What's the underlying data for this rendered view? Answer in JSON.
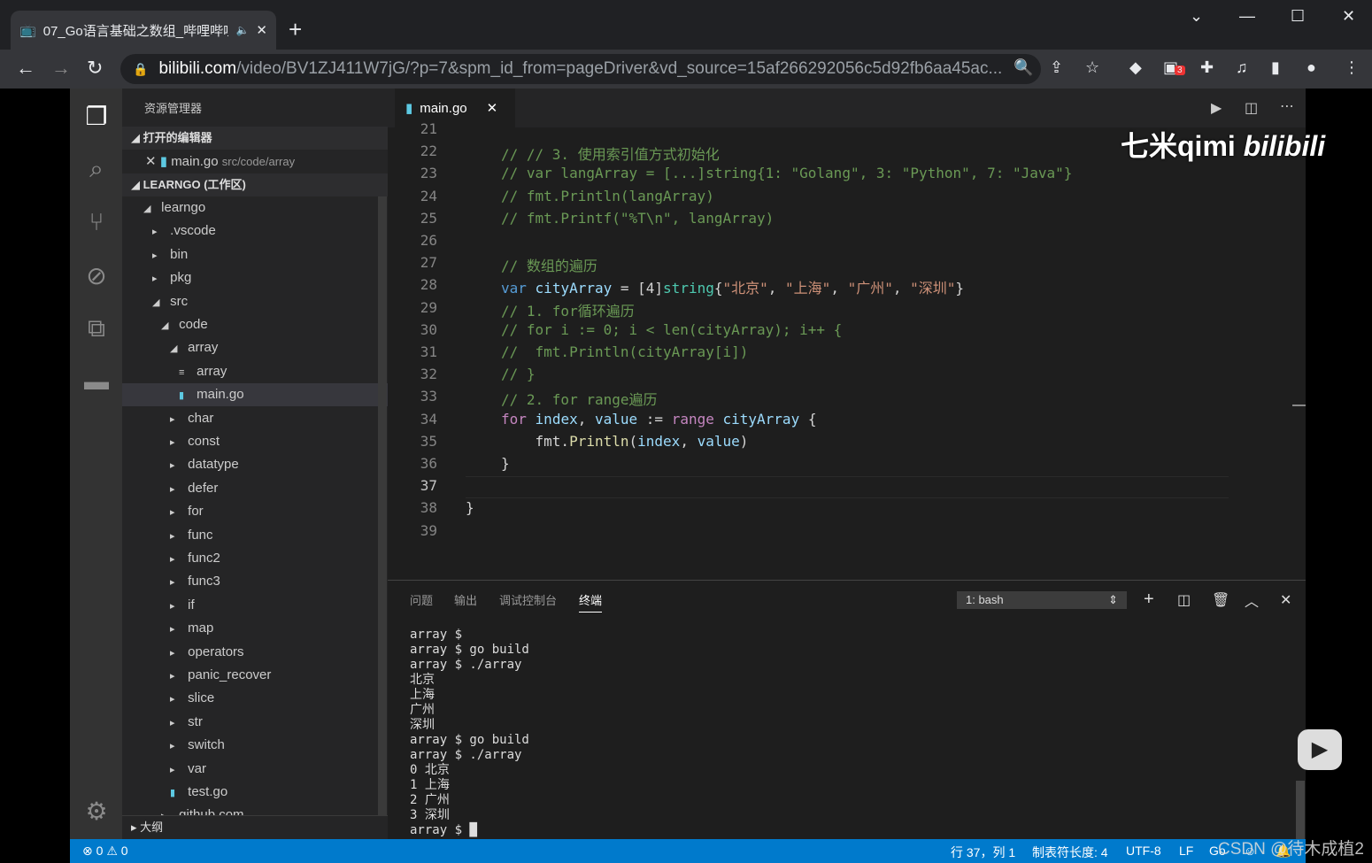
{
  "browser": {
    "tab_title": "07_Go语言基础之数组_哔哩哔哩",
    "url_host": "bilibili.com",
    "url_path": "/video/BV1ZJ411W7jG/?p=7&spm_id_from=pageDriver&vd_source=15af266292056c5d92fb6aa45ac...",
    "extension_badge": "3"
  },
  "sidebar": {
    "title": "资源管理器",
    "open_editors": "打开的编辑器",
    "open_file": "main.go",
    "open_file_path": "src/code/array",
    "workspace": "LEARNGO (工作区)",
    "outline": "大纲",
    "tree": [
      {
        "label": "learngo",
        "depth": 0,
        "type": "open"
      },
      {
        "label": ".vscode",
        "depth": 1,
        "type": "closed"
      },
      {
        "label": "bin",
        "depth": 1,
        "type": "closed"
      },
      {
        "label": "pkg",
        "depth": 1,
        "type": "closed"
      },
      {
        "label": "src",
        "depth": 1,
        "type": "open"
      },
      {
        "label": "code",
        "depth": 2,
        "type": "open"
      },
      {
        "label": "array",
        "depth": 3,
        "type": "open"
      },
      {
        "label": "array",
        "depth": 4,
        "type": "bin"
      },
      {
        "label": "main.go",
        "depth": 4,
        "type": "go",
        "selected": true
      },
      {
        "label": "char",
        "depth": 3,
        "type": "closed"
      },
      {
        "label": "const",
        "depth": 3,
        "type": "closed"
      },
      {
        "label": "datatype",
        "depth": 3,
        "type": "closed"
      },
      {
        "label": "defer",
        "depth": 3,
        "type": "closed"
      },
      {
        "label": "for",
        "depth": 3,
        "type": "closed"
      },
      {
        "label": "func",
        "depth": 3,
        "type": "closed"
      },
      {
        "label": "func2",
        "depth": 3,
        "type": "closed"
      },
      {
        "label": "func3",
        "depth": 3,
        "type": "closed"
      },
      {
        "label": "if",
        "depth": 3,
        "type": "closed"
      },
      {
        "label": "map",
        "depth": 3,
        "type": "closed"
      },
      {
        "label": "operators",
        "depth": 3,
        "type": "closed"
      },
      {
        "label": "panic_recover",
        "depth": 3,
        "type": "closed"
      },
      {
        "label": "slice",
        "depth": 3,
        "type": "closed"
      },
      {
        "label": "str",
        "depth": 3,
        "type": "closed"
      },
      {
        "label": "switch",
        "depth": 3,
        "type": "closed"
      },
      {
        "label": "var",
        "depth": 3,
        "type": "closed"
      },
      {
        "label": "test.go",
        "depth": 3,
        "type": "go"
      },
      {
        "label": "github.com",
        "depth": 2,
        "type": "closed"
      }
    ]
  },
  "editor": {
    "tab": "main.go",
    "first_line": 21,
    "lines": [
      "",
      "<c>// // 3. 使用索引值方式初始化</c>",
      "<c>// var langArray = [...]string{1: \"Golang\", 3: \"Python\", 7: \"Java\"}</c>",
      "<c>// fmt.Println(langArray)</c>",
      "<c>// fmt.Printf(\"%T\\n\", langArray)</c>",
      "",
      "<c>// 数组的遍历</c>",
      "<k>var</k> <v>cityArray</v> = [4]<ty>string</ty>{<s>\"北京\"</s>, <s>\"上海\"</s>, <s>\"广州\"</s>, <s>\"深圳\"</s>}",
      "<c>// 1. for循环遍历</c>",
      "<c>// for i := 0; i < len(cityArray); i++ {</c>",
      "<c>//  fmt.Println(cityArray[i])</c>",
      "<c>// }</c>",
      "<c>// 2. for range遍历</c>",
      "<p>for</p> <v>index</v>, <v>value</v> := <p>range</p> <v>cityArray</v> {",
      "    fmt.<f>Println</f>(<v>index</v>, <v>value</v>)",
      "}",
      "",
      "}",
      ""
    ],
    "indent": [
      0,
      1,
      1,
      1,
      1,
      0,
      1,
      1,
      1,
      1,
      1,
      1,
      1,
      1,
      1,
      1,
      0,
      0,
      0
    ],
    "current_line": 37
  },
  "panel": {
    "tabs": [
      "问题",
      "输出",
      "调试控制台",
      "终端"
    ],
    "active": 3,
    "terminal_select": "1: bash",
    "terminal": [
      "array $",
      "array $ go build",
      "array $ ./array",
      "北京",
      "上海",
      "广州",
      "深圳",
      "array $ go build",
      "array $ ./array",
      "0 北京",
      "1 上海",
      "2 广州",
      "3 深圳",
      "array $ "
    ]
  },
  "status": {
    "errors": "0",
    "warnings": "0",
    "position": "行 37，列 1",
    "tab_size": "制表符长度: 4",
    "encoding": "UTF-8",
    "eol": "LF",
    "language": "Go"
  },
  "watermark": {
    "logo": "七米qimi bilibili",
    "csdn": "CSDN @待木成植2"
  },
  "colors": {
    "status_bar": "#007acc",
    "editor_bg": "#1e1e1e",
    "comment": "#6a9955"
  }
}
